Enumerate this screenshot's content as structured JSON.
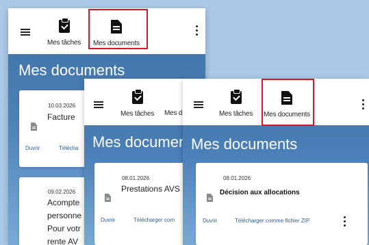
{
  "nav": {
    "tasks_label": "Mes tâches",
    "documents_label": "Mes documents",
    "documents_label_truncated": "Mes d"
  },
  "page": {
    "title": "Mes documents",
    "title_truncated": "Mes documen"
  },
  "screen1": {
    "cards": [
      {
        "date": "10.03.2026",
        "title": "Facture",
        "open": "Duvrir",
        "download": "Télécha"
      },
      {
        "date": "09.02.2026",
        "title_lines": [
          "Acompte",
          "personne",
          "Pour votr",
          "rente AV"
        ]
      }
    ]
  },
  "screen2": {
    "card": {
      "date": "08.01.2026",
      "title": "Prestations AVS",
      "open": "Duvrir",
      "download": "Télécharger com"
    }
  },
  "screen3": {
    "card": {
      "date": "08.01.2026",
      "title": "Décision aux allocations",
      "open": "Duvrir",
      "download": "Télécharger comme fichier ZIP"
    }
  },
  "colors": {
    "highlight": "#e0141b",
    "link": "#2e5c9a",
    "header_bg": "#ffffff"
  },
  "icons": [
    "menu-icon",
    "clipboard-check-icon",
    "document-icon",
    "more-vert-icon",
    "file-icon"
  ]
}
